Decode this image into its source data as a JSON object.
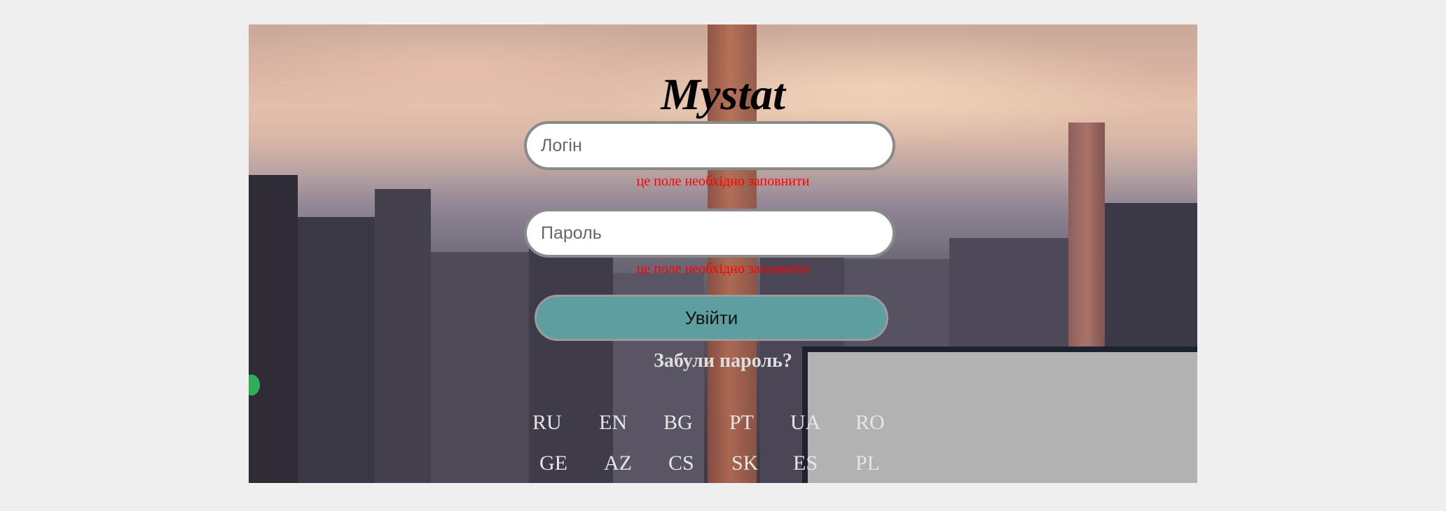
{
  "app": {
    "title": "Mystat"
  },
  "login": {
    "login_placeholder": "Логін",
    "login_value": "",
    "password_placeholder": "Пароль",
    "password_value": "",
    "required_error": "це поле необхідно заповнити",
    "submit_label": "Увійти",
    "forgot_label": "Забули пароль?"
  },
  "languages": {
    "row1": [
      "RU",
      "EN",
      "BG",
      "PT",
      "UA",
      "RO"
    ],
    "row2": [
      "GE",
      "AZ",
      "CS",
      "SK",
      "ES",
      "PL"
    ]
  },
  "colors": {
    "page_background": "#efefef",
    "button": "#5f9ea0",
    "error": "#ff0000"
  }
}
